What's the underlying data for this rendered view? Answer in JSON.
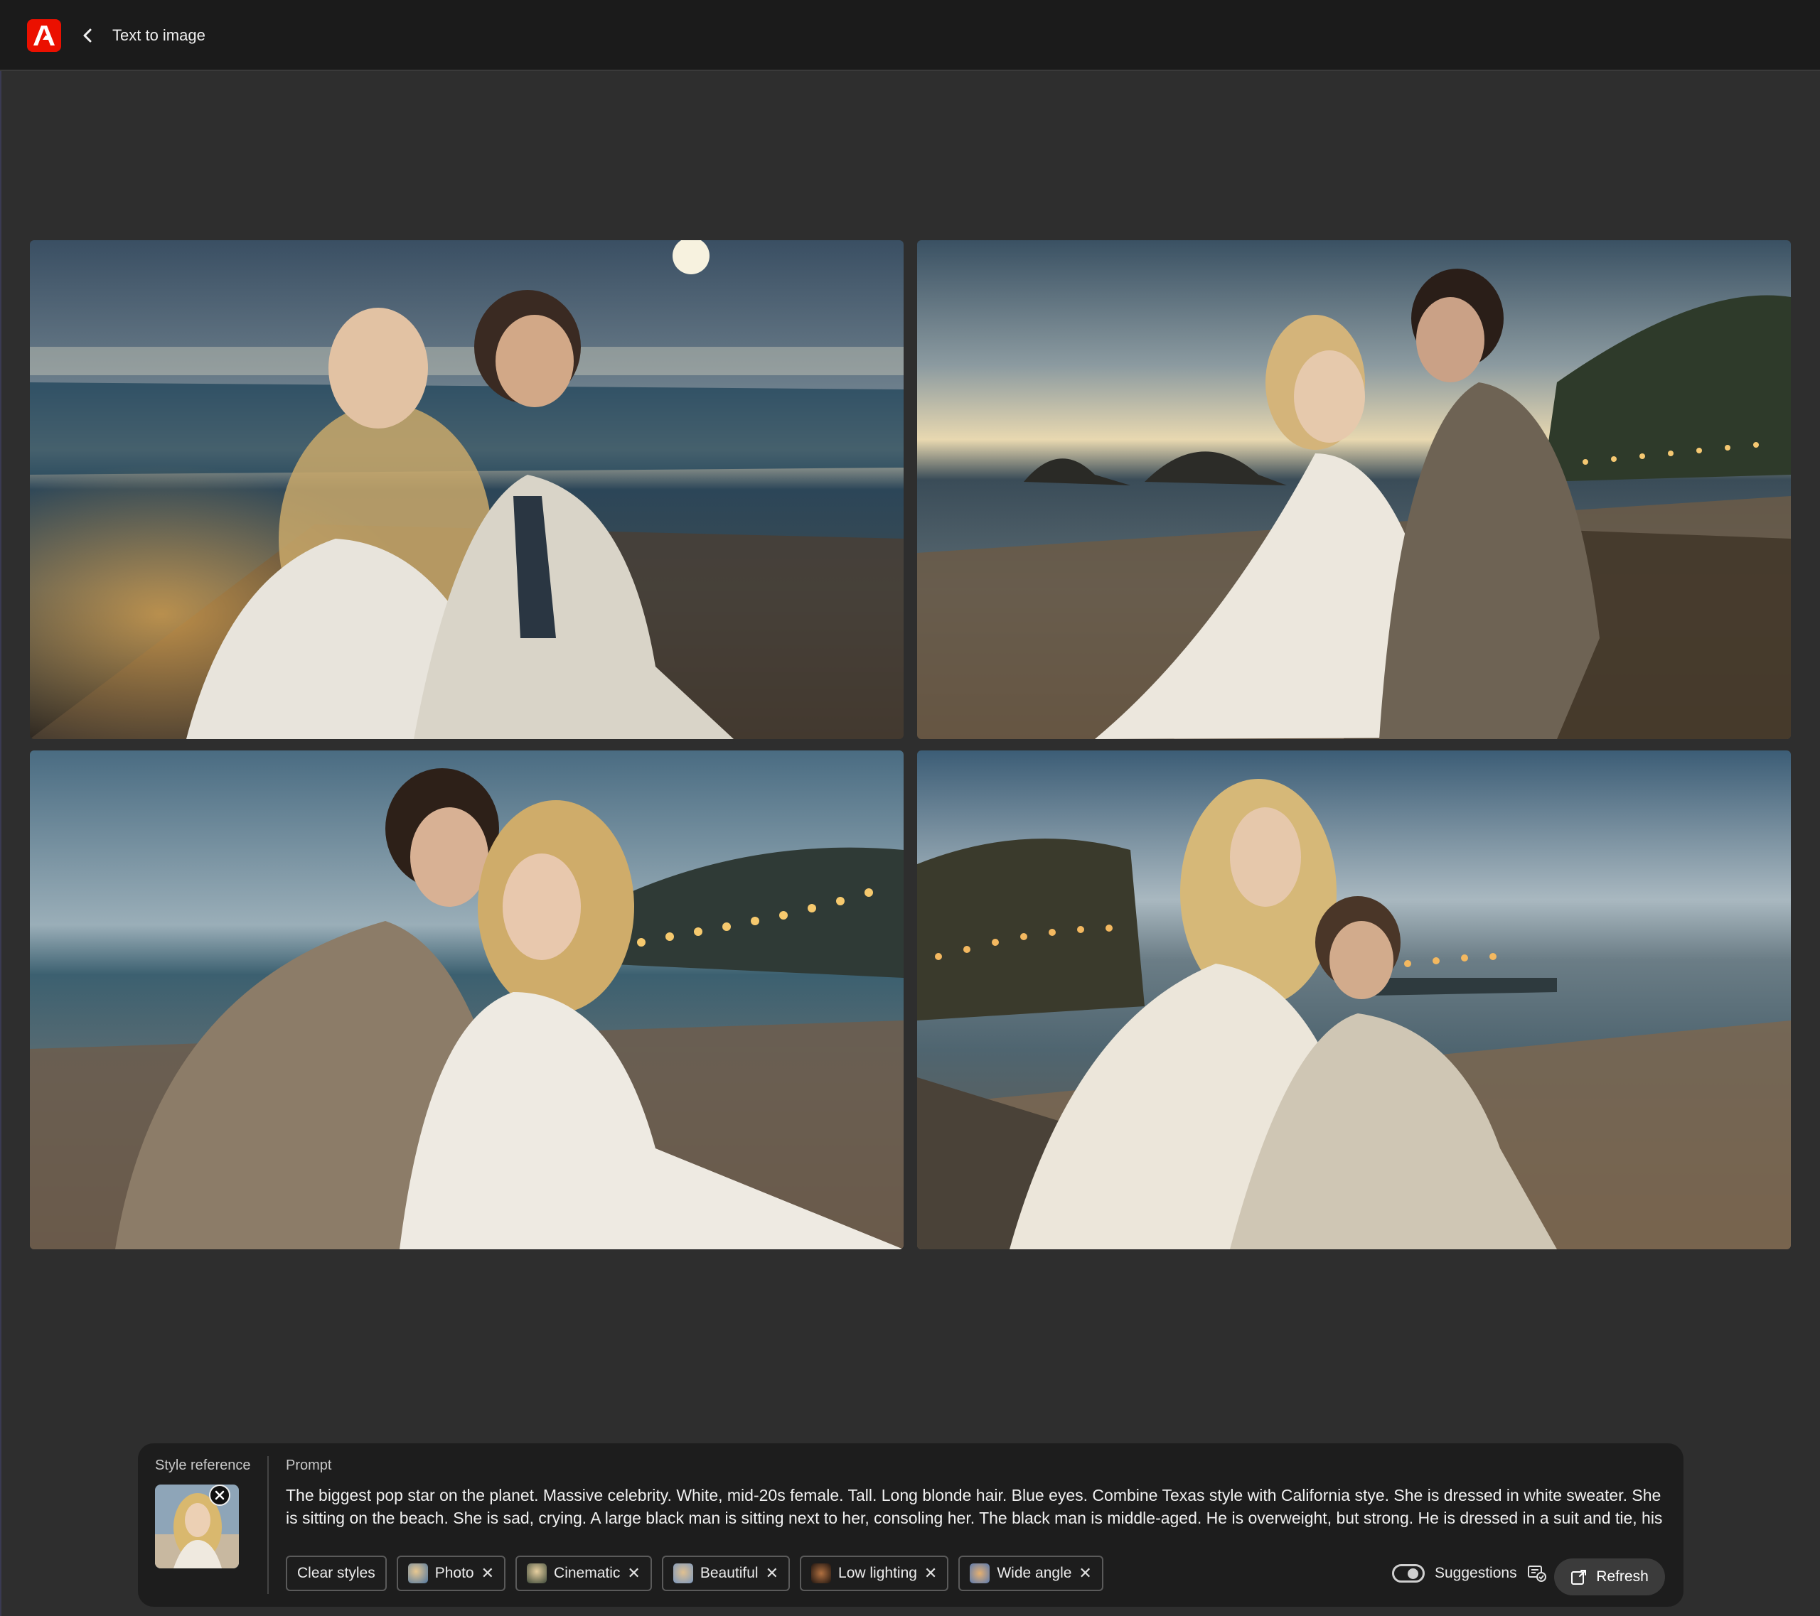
{
  "header": {
    "title": "Text to image",
    "logo_icon": "adobe-logo",
    "back_icon": "chevron-left-icon"
  },
  "images": [
    {
      "alt": "Two women sitting on a moonlit beach"
    },
    {
      "alt": "Couple sitting on a beach at dusk"
    },
    {
      "alt": "Couple on beach with bokeh lights"
    },
    {
      "alt": "Two people sitting on a seawall at dusk"
    }
  ],
  "panel": {
    "style_reference_label": "Style reference",
    "prompt_label": "Prompt",
    "prompt_text": "The biggest pop star on the planet. Massive celebrity. White, mid-20s female. Tall. Long blonde hair. Blue eyes. Combine Texas style with California stye. She is dressed in white sweater. She is sitting on the beach. She is sad, crying. A large black man is sitting next to her, consoling her. The black man is middle-aged. He is overweight, but strong. He is dressed in a suit and tie, his collar",
    "clear_styles_label": "Clear styles",
    "chips": [
      {
        "label": "Photo",
        "color": "#6b8fb5"
      },
      {
        "label": "Cinematic",
        "color": "#8a7a5a"
      },
      {
        "label": "Beautiful",
        "color": "#9db3cf"
      },
      {
        "label": "Low lighting",
        "color": "#5a3a22"
      },
      {
        "label": "Wide angle",
        "color": "#7f9cc4"
      }
    ],
    "suggestions_label": "Suggestions",
    "suggestions_on": true,
    "refresh_label": "Refresh"
  },
  "colors": {
    "brand": "#eb1000",
    "background": "#2e2e2e",
    "topbar": "#1b1b1b",
    "panel": "#1d1d1d"
  }
}
